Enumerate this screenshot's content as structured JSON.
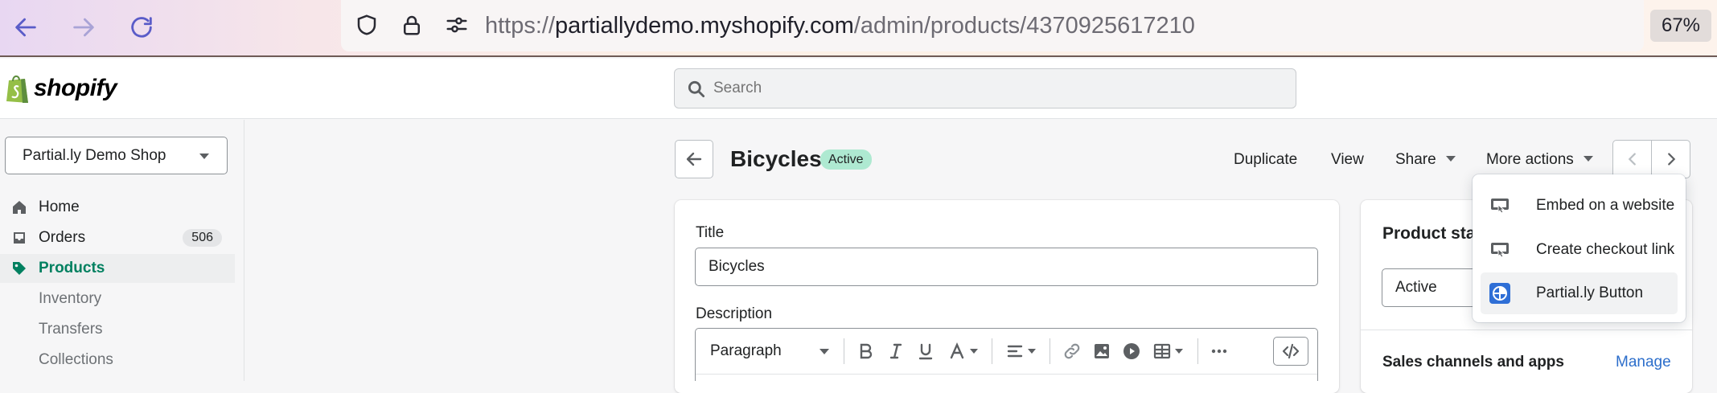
{
  "browser": {
    "url_prefix": "https://",
    "url_host": "partiallydemo.myshopify.com",
    "url_path": "/admin/products/4370925617210",
    "zoom": "67%"
  },
  "topbar": {
    "logo_text": "shopify",
    "search_placeholder": "Search"
  },
  "sidebar": {
    "store_name": "Partial.ly Demo Shop",
    "items": [
      {
        "label": "Home",
        "icon": "home-icon"
      },
      {
        "label": "Orders",
        "icon": "inbox-icon",
        "count": "506"
      },
      {
        "label": "Products",
        "icon": "tag-icon",
        "active": true
      },
      {
        "label": "Inventory"
      },
      {
        "label": "Transfers"
      },
      {
        "label": "Collections"
      }
    ]
  },
  "page": {
    "title": "Bicycles",
    "status": "Active",
    "actions": {
      "duplicate": "Duplicate",
      "view": "View",
      "share": "Share",
      "more": "More actions"
    }
  },
  "form": {
    "title_label": "Title",
    "title_value": "Bicycles",
    "description_label": "Description",
    "paragraph_label": "Paragraph"
  },
  "status_card": {
    "title": "Product sta",
    "status_value": "Active",
    "sales_title": "Sales channels and apps",
    "manage": "Manage"
  },
  "more_actions_menu": {
    "items": [
      {
        "label": "Embed on a website",
        "icon": "app-icon"
      },
      {
        "label": "Create checkout link",
        "icon": "app-icon"
      },
      {
        "label": "Partial.ly Button",
        "icon": "partially-icon",
        "highlighted": true
      }
    ]
  },
  "colors": {
    "accent": "#008060",
    "badge_active": "#aee9d1",
    "link": "#2c6ecb"
  }
}
